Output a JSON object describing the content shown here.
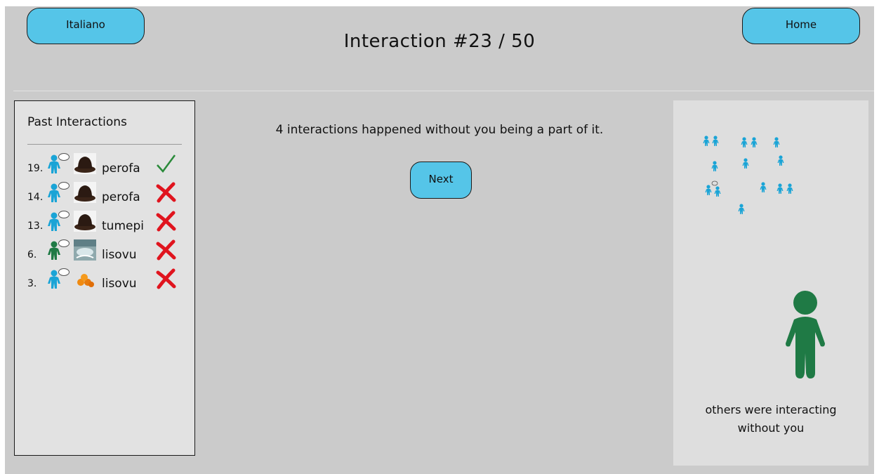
{
  "header": {
    "language_label": "Italiano",
    "home_label": "Home",
    "title": "Interaction #23 / 50"
  },
  "history": {
    "title": "Past Interactions",
    "items": [
      {
        "number": "19.",
        "word": "perofa",
        "result": "correct",
        "person_color": "#1aa4d6",
        "thumb": "hat"
      },
      {
        "number": "14.",
        "word": "perofa",
        "result": "wrong",
        "person_color": "#1aa4d6",
        "thumb": "hat"
      },
      {
        "number": "13.",
        "word": "tumepi",
        "result": "wrong",
        "person_color": "#1aa4d6",
        "thumb": "hat"
      },
      {
        "number": "6.",
        "word": "lisovu",
        "result": "wrong",
        "person_color": "#1f7a45",
        "thumb": "photo"
      },
      {
        "number": "3.",
        "word": "lisovu",
        "result": "wrong",
        "person_color": "#1aa4d6",
        "thumb": "oranges"
      }
    ]
  },
  "main": {
    "message": "4 interactions happened without you being a part of it.",
    "next_label": "Next"
  },
  "side_panel": {
    "caption_line1": "others were interacting",
    "caption_line2": "without you"
  },
  "colors": {
    "accent": "#55c5e8",
    "blue_person": "#1aa4d6",
    "green_person": "#1f7a45",
    "correct": "#2a8a3a",
    "wrong": "#e0141e"
  }
}
